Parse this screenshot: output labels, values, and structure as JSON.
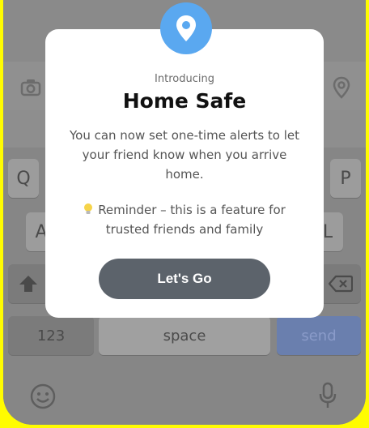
{
  "modal": {
    "intro": "Introducing",
    "title": "Home Safe",
    "description": "You can now set one-time alerts to let your friend know when you arrive home.",
    "reminder": "Reminder – this is a feature for trusted friends and family",
    "cta_label": "Let's Go"
  },
  "keyboard": {
    "row1": [
      "Q",
      "P"
    ],
    "row2": [
      "A",
      "L"
    ],
    "bottom": {
      "numbers": "123",
      "space": "space",
      "send": "send"
    }
  },
  "colors": {
    "background": "#FFFC00",
    "badge": "#5aa8f0",
    "cta": "#5c636b"
  },
  "icons": [
    "location-pin-icon",
    "camera-icon",
    "map-pin-icon",
    "shift-icon",
    "backspace-icon",
    "emoji-icon",
    "microphone-icon",
    "lightbulb-icon"
  ]
}
